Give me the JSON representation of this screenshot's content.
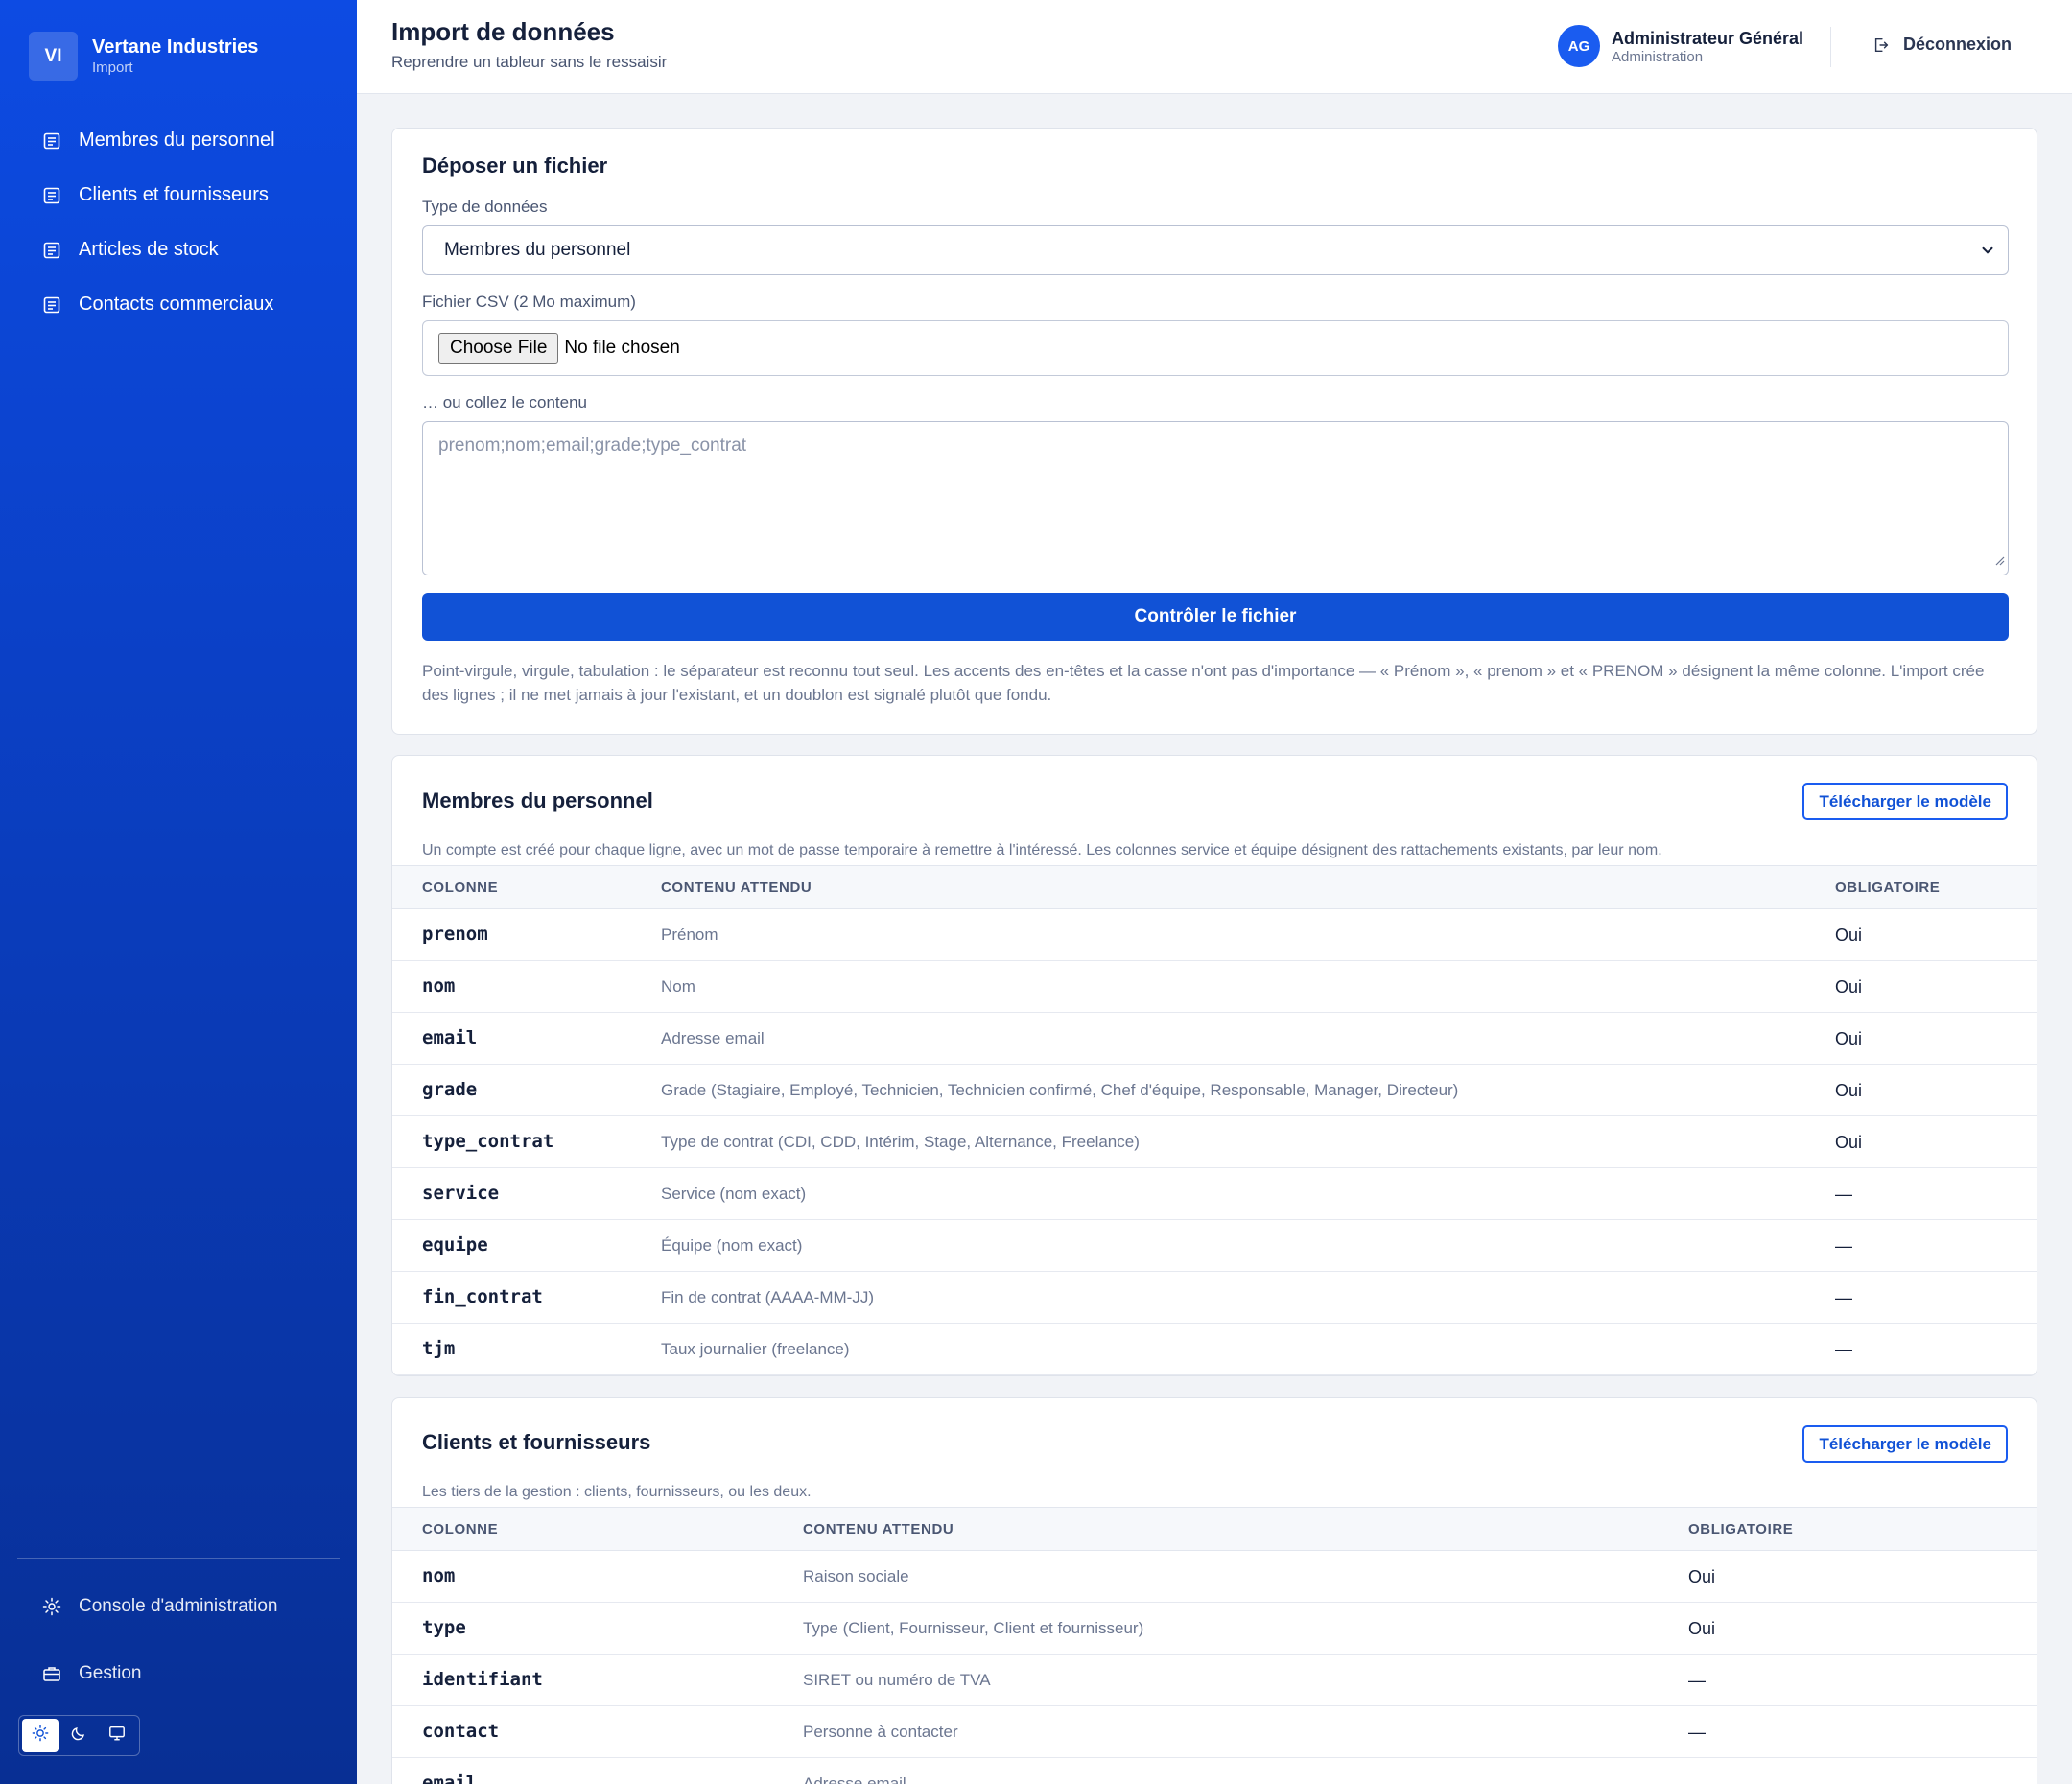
{
  "brand": {
    "initials": "VI",
    "name": "Vertane Industries",
    "section": "Import"
  },
  "sidebar": {
    "items": [
      {
        "label": "Membres du personnel",
        "icon": "document-icon"
      },
      {
        "label": "Clients et fournisseurs",
        "icon": "document-icon"
      },
      {
        "label": "Articles de stock",
        "icon": "document-icon"
      },
      {
        "label": "Contacts commerciaux",
        "icon": "document-icon"
      }
    ],
    "bottom": [
      {
        "label": "Console d'administration",
        "icon": "gear-icon"
      },
      {
        "label": "Gestion",
        "icon": "briefcase-icon"
      }
    ],
    "theme": {
      "active": "light",
      "options": [
        "sun-icon",
        "moon-icon",
        "monitor-icon"
      ]
    }
  },
  "header": {
    "title": "Import de données",
    "subtitle": "Reprendre un tableur sans le ressaisir",
    "user": {
      "initials": "AG",
      "name": "Administrateur Général",
      "role": "Administration"
    },
    "logout_label": "Déconnexion"
  },
  "upload": {
    "title": "Déposer un fichier",
    "type_label": "Type de données",
    "type_value": "Membres du personnel",
    "file_label": "Fichier CSV (2 Mo maximum)",
    "file_button": "Choose File",
    "file_status": "No file chosen",
    "paste_label": "… ou collez le contenu",
    "paste_placeholder": "prenom;nom;email;grade;type_contrat",
    "submit_label": "Contrôler le fichier",
    "help_text": "Point-virgule, virgule, tabulation : le séparateur est reconnu tout seul. Les accents des en-têtes et la casse n'ont pas d'importance — « Prénom », « prenom » et « PRENOM » désignent la même colonne. L'import crée des lignes ; il ne met jamais à jour l'existant, et un doublon est signalé plutôt que fondu."
  },
  "staff": {
    "title": "Membres du personnel",
    "download_label": "Télécharger le modèle",
    "description": "Un compte est créé pour chaque ligne, avec un mot de passe temporaire à remettre à l'intéressé. Les colonnes service et équipe désignent des rattachements existants, par leur nom.",
    "headers": {
      "col": "COLONNE",
      "desc": "CONTENU ATTENDU",
      "req": "OBLIGATOIRE"
    },
    "rows": [
      {
        "col": "prenom",
        "desc": "Prénom",
        "req": "Oui"
      },
      {
        "col": "nom",
        "desc": "Nom",
        "req": "Oui"
      },
      {
        "col": "email",
        "desc": "Adresse email",
        "req": "Oui"
      },
      {
        "col": "grade",
        "desc": "Grade (Stagiaire, Employé, Technicien, Technicien confirmé, Chef d'équipe, Responsable, Manager, Directeur)",
        "req": "Oui"
      },
      {
        "col": "type_contrat",
        "desc": "Type de contrat (CDI, CDD, Intérim, Stage, Alternance, Freelance)",
        "req": "Oui"
      },
      {
        "col": "service",
        "desc": "Service (nom exact)",
        "req": "—"
      },
      {
        "col": "equipe",
        "desc": "Équipe (nom exact)",
        "req": "—"
      },
      {
        "col": "fin_contrat",
        "desc": "Fin de contrat (AAAA-MM-JJ)",
        "req": "—"
      },
      {
        "col": "tjm",
        "desc": "Taux journalier (freelance)",
        "req": "—"
      }
    ]
  },
  "partners": {
    "title": "Clients et fournisseurs",
    "download_label": "Télécharger le modèle",
    "description": "Les tiers de la gestion : clients, fournisseurs, ou les deux.",
    "headers": {
      "col": "COLONNE",
      "desc": "CONTENU ATTENDU",
      "req": "OBLIGATOIRE"
    },
    "rows": [
      {
        "col": "nom",
        "desc": "Raison sociale",
        "req": "Oui"
      },
      {
        "col": "type",
        "desc": "Type (Client, Fournisseur, Client et fournisseur)",
        "req": "Oui"
      },
      {
        "col": "identifiant",
        "desc": "SIRET ou numéro de TVA",
        "req": "—"
      },
      {
        "col": "contact",
        "desc": "Personne à contacter",
        "req": "—"
      },
      {
        "col": "email",
        "desc": "Adresse email",
        "req": "—"
      }
    ]
  },
  "colors": {
    "accent": "#1152d6",
    "sidebar_top": "#0d4be3",
    "sidebar_bottom": "#082f94"
  }
}
